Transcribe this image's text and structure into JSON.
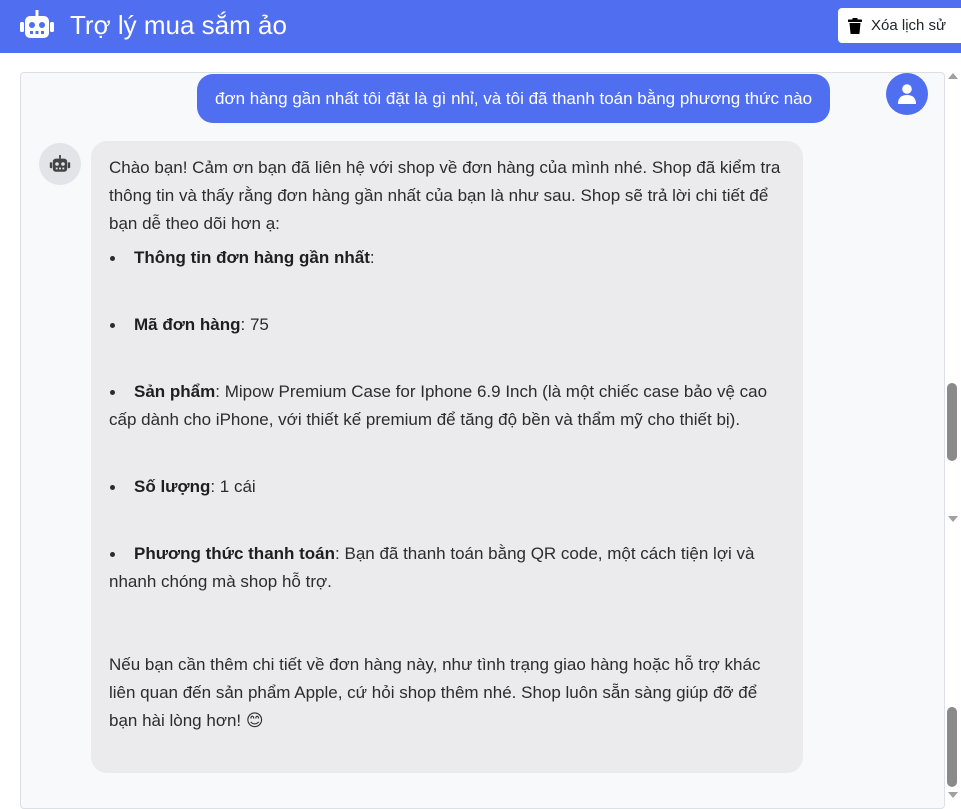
{
  "header": {
    "title": "Trợ lý mua sắm ảo",
    "clear_label": "Xóa lịch sử",
    "bot_icon": "robot-icon",
    "trash_icon": "trash-icon",
    "background": "#4f6ef0"
  },
  "conversation": {
    "user_message": "đơn hàng gần nhất tôi đặt là gì nhỉ, và tôi đã thanh toán bằng phương thức nào",
    "bot_message": {
      "intro": "Chào bạn! Cảm ơn bạn đã liên hệ với shop về đơn hàng của mình nhé. Shop đã kiểm tra thông tin và thấy rằng đơn hàng gần nhất của bạn là như sau. Shop sẽ trả lời chi tiết để bạn dễ theo dõi hơn ạ:",
      "items": [
        {
          "label": "Thông tin đơn hàng gần nhất",
          "value": ":"
        },
        {
          "label": "Mã đơn hàng",
          "value": ": 75"
        },
        {
          "label": "Sản phẩm",
          "value": ": Mipow Premium Case for Iphone 6.9 Inch (là một chiếc case bảo vệ cao cấp dành cho iPhone, với thiết kế premium để tăng độ bền và thẩm mỹ cho thiết bị)."
        },
        {
          "label": "Số lượng",
          "value": ": 1 cái"
        },
        {
          "label": "Phương thức thanh toán",
          "value": ": Bạn đã thanh toán bằng QR code, một cách tiện lợi và nhanh chóng mà shop hỗ trợ."
        }
      ],
      "closing": "Nếu bạn cần thêm chi tiết về đơn hàng này, như tình trạng giao hàng hoặc hỗ trợ khác liên quan đến sản phẩm Apple, cứ hỏi shop thêm nhé. Shop luôn sẵn sàng giúp đỡ để bạn hài lòng hơn! 😊"
    }
  }
}
